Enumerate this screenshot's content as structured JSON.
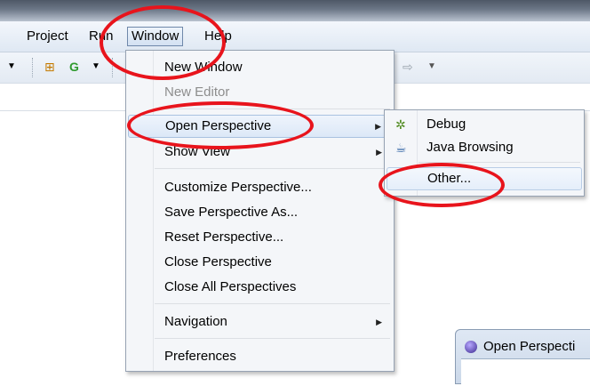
{
  "menubar": {
    "items": [
      {
        "label": "Project"
      },
      {
        "label": "Run"
      },
      {
        "label": "Window"
      },
      {
        "label": "Help"
      }
    ]
  },
  "toolbar": {
    "icons": [
      "dropdown-arrow",
      "new-class-icon",
      "run-icon",
      "dropdown-arrow",
      "forward-arrow-icon",
      "dropdown-arrow"
    ]
  },
  "window_menu": {
    "items": [
      {
        "label": "New Window",
        "enabled": true
      },
      {
        "label": "New Editor",
        "enabled": false
      },
      {
        "label": "Open Perspective",
        "submenu": true,
        "highlighted": true
      },
      {
        "label": "Show View",
        "submenu": true
      },
      {
        "label": "Customize Perspective..."
      },
      {
        "label": "Save Perspective As..."
      },
      {
        "label": "Reset Perspective..."
      },
      {
        "label": "Close Perspective"
      },
      {
        "label": "Close All Perspectives"
      },
      {
        "label": "Navigation",
        "submenu": true
      },
      {
        "label": "Preferences"
      }
    ]
  },
  "perspective_submenu": {
    "items": [
      {
        "label": "Debug",
        "icon": "debug-bug-icon"
      },
      {
        "label": "Java Browsing",
        "icon": "java-browsing-icon"
      },
      {
        "label": "Other...",
        "highlighted": true
      }
    ]
  },
  "dialog": {
    "title": "Open Perspecti"
  },
  "colors": {
    "annotation": "#e8141c",
    "menu_bg": "#f4f6f9",
    "highlight_border": "#a9c2e0"
  }
}
